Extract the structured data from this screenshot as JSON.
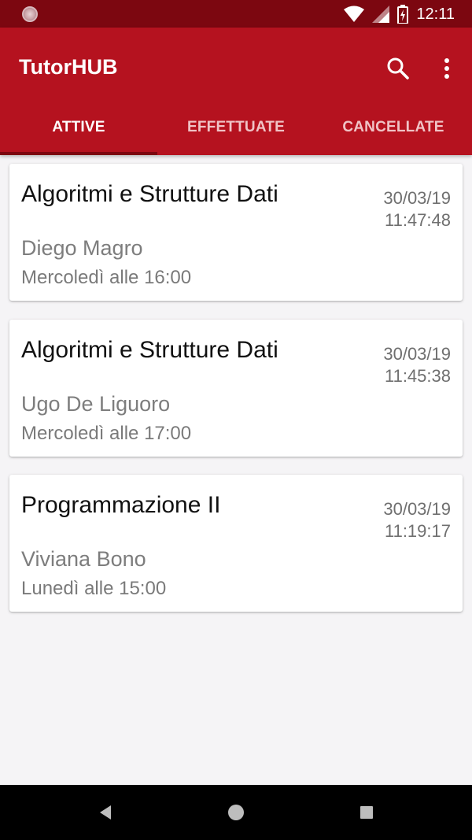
{
  "status_bar": {
    "time": "12:11",
    "icons": [
      "notification-icon",
      "wifi-icon",
      "signal-icon",
      "battery-charging-icon"
    ]
  },
  "app_bar": {
    "title": "TutorHUB",
    "actions": [
      "search-icon",
      "more-vert-icon"
    ]
  },
  "tabs": [
    {
      "label": "ATTIVE",
      "active": true
    },
    {
      "label": "EFFETTUATE",
      "active": false
    },
    {
      "label": "CANCELLATE",
      "active": false
    }
  ],
  "bookings": [
    {
      "course": "Algoritmi e Strutture Dati",
      "date": "30/03/19",
      "time": "11:47:48",
      "tutor": "Diego Magro",
      "slot": "Mercoledì alle 16:00"
    },
    {
      "course": "Algoritmi e Strutture Dati",
      "date": "30/03/19",
      "time": "11:45:38",
      "tutor": "Ugo De Liguoro",
      "slot": "Mercoledì alle 17:00"
    },
    {
      "course": "Programmazione II",
      "date": "30/03/19",
      "time": "11:19:17",
      "tutor": "Viviana Bono",
      "slot": "Lunedì alle 15:00"
    }
  ],
  "nav_bar": [
    "back-icon",
    "home-icon",
    "recents-icon"
  ],
  "colors": {
    "primary": "#b5121f",
    "primary_dark": "#7c0710",
    "background": "#f5f4f6"
  }
}
